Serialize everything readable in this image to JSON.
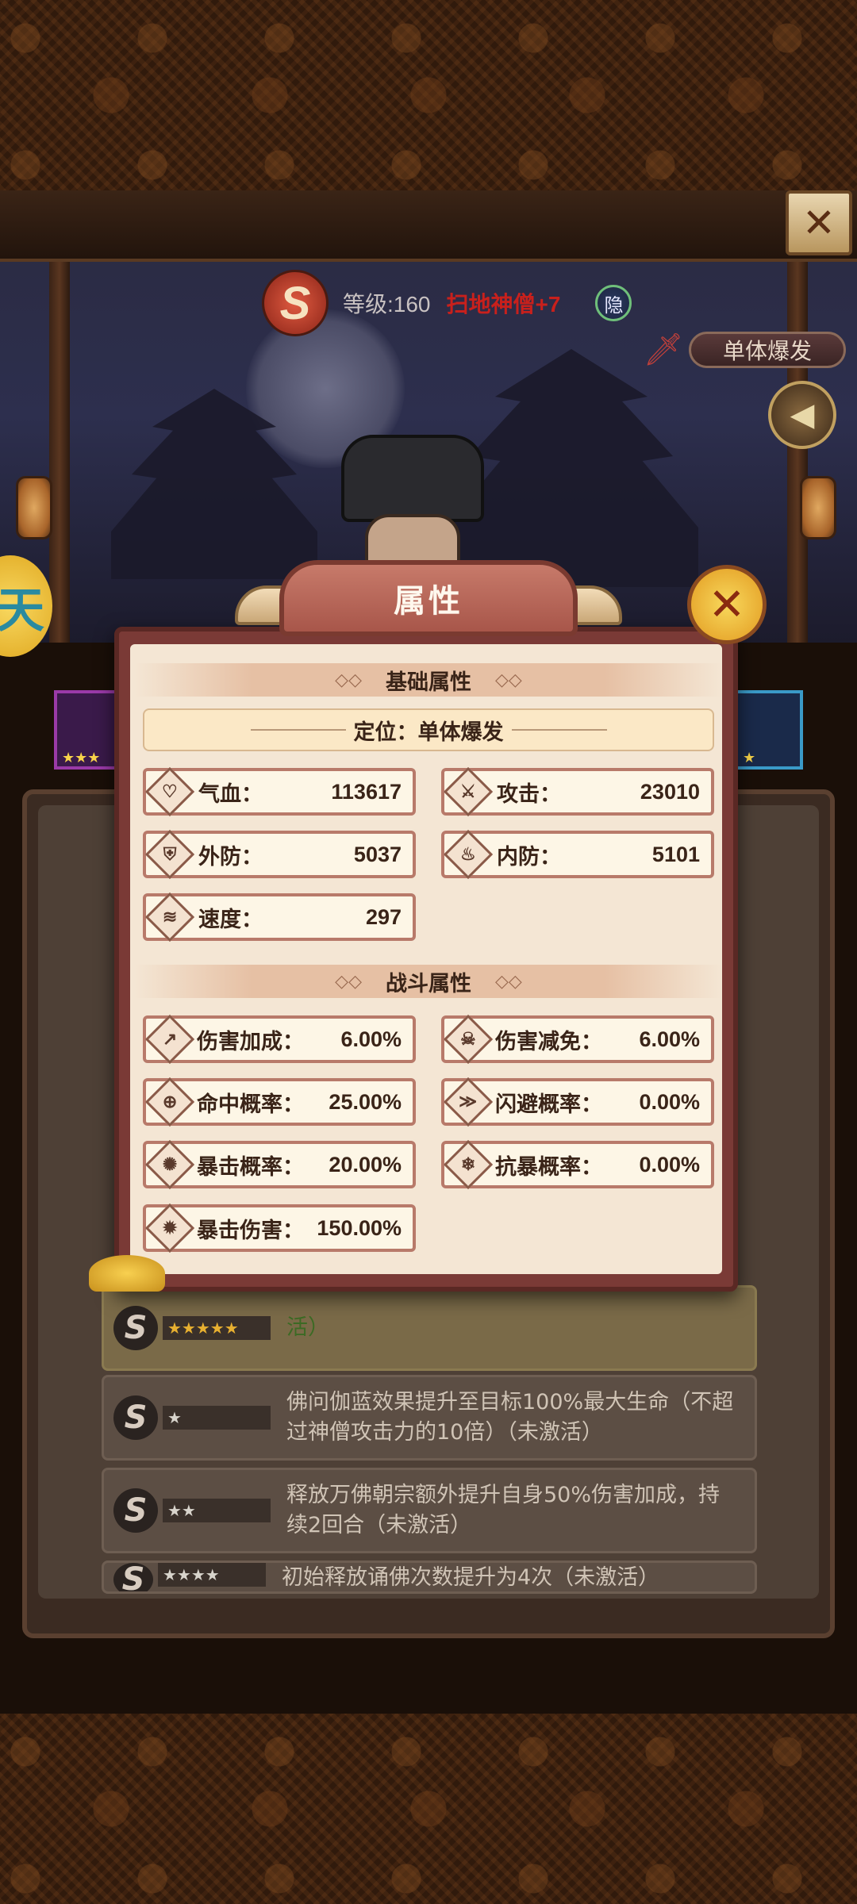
{
  "header": {
    "level_text": "等级:160",
    "name_text": "扫地神僧+7",
    "hide_badge": "隐",
    "role_tag": "单体爆发",
    "close_symbol": "✕"
  },
  "side_badge": "天",
  "modal": {
    "title": "属性",
    "close_symbol": "✕",
    "basic_header": "基础属性",
    "position_text": "定位：单体爆发",
    "combat_header": "战斗属性"
  },
  "basic_stats": [
    {
      "label": "气血：",
      "value": "113617",
      "icon": "heart-icon",
      "glyph": "♡"
    },
    {
      "label": "攻击：",
      "value": "23010",
      "icon": "sword-icon",
      "glyph": "⚔"
    },
    {
      "label": "外防：",
      "value": "5037",
      "icon": "shield-icon",
      "glyph": "⛨"
    },
    {
      "label": "内防：",
      "value": "5101",
      "icon": "flame-icon",
      "glyph": "♨"
    },
    {
      "label": "速度：",
      "value": "297",
      "icon": "wind-icon",
      "glyph": "≋"
    }
  ],
  "combat_stats": [
    {
      "label": "伤害加成：",
      "value": "6.00%",
      "icon": "damage-up-icon",
      "glyph": "↗"
    },
    {
      "label": "伤害减免：",
      "value": "6.00%",
      "icon": "skull-icon",
      "glyph": "☠"
    },
    {
      "label": "命中概率：",
      "value": "25.00%",
      "icon": "target-icon",
      "glyph": "⊕"
    },
    {
      "label": "闪避概率：",
      "value": "0.00%",
      "icon": "dodge-icon",
      "glyph": "≫"
    },
    {
      "label": "暴击概率：",
      "value": "20.00%",
      "icon": "crit-icon",
      "glyph": "✺"
    },
    {
      "label": "抗暴概率：",
      "value": "0.00%",
      "icon": "resist-icon",
      "glyph": "❄"
    },
    {
      "label": "暴击伤害：",
      "value": "150.00%",
      "icon": "crit-damage-icon",
      "glyph": "✹"
    }
  ],
  "background_skills": [
    {
      "stars": "★★★★★",
      "desc": "活）",
      "status": "active"
    },
    {
      "stars": "★",
      "desc": "佛问伽蓝效果提升至目标100%最大生命（不超过神僧攻击力的10倍）（未激活）",
      "status": "inactive"
    },
    {
      "stars": "★★",
      "desc": "释放万佛朝宗额外提升自身50%伤害加成，持续2回合（未激活）",
      "status": "inactive"
    },
    {
      "stars": "★★★★",
      "desc": "初始释放诵佛次数提升为4次（未激活）",
      "status": "inactive"
    }
  ],
  "colors": {
    "accent_red": "#c8201c",
    "modal_frame": "#7a3a36",
    "modal_body": "#f4e6d4",
    "stat_border": "#b87a6a",
    "gold": "#f8d85c"
  }
}
